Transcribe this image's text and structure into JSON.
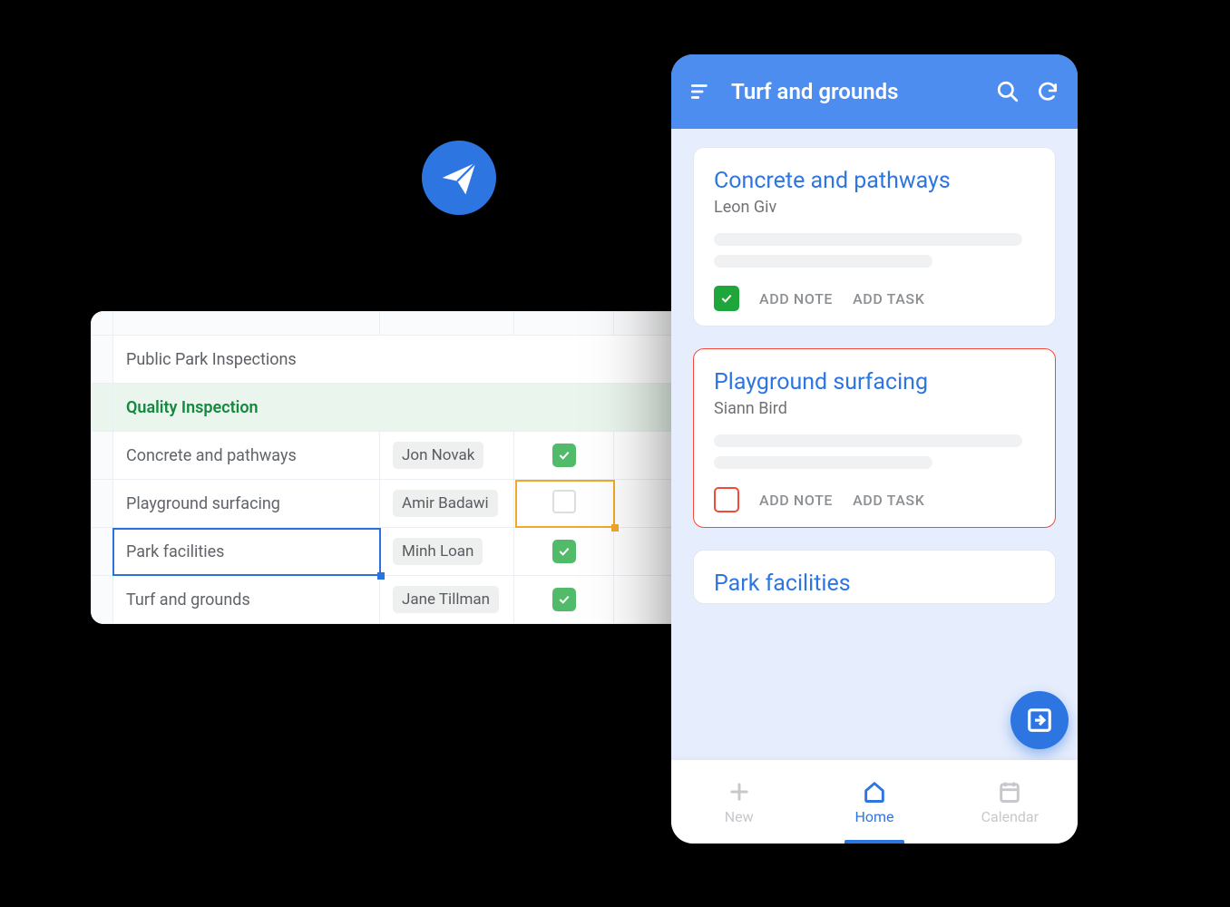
{
  "spreadsheet": {
    "title": "Public Park Inspections",
    "section": "Quality Inspection",
    "rows": [
      {
        "task": "Concrete and pathways",
        "person": "Jon Novak",
        "checked": true
      },
      {
        "task": "Playground surfacing",
        "person": "Amir Badawi",
        "checked": false
      },
      {
        "task": "Park facilities",
        "person": "Minh Loan",
        "checked": true
      },
      {
        "task": "Turf and grounds",
        "person": "Jane Tillman",
        "checked": true
      }
    ]
  },
  "phone": {
    "header_title": "Turf and grounds",
    "cards": [
      {
        "title": "Concrete and pathways",
        "person": "Leon Giv",
        "checked": true,
        "outline": "none"
      },
      {
        "title": "Playground surfacing",
        "person": "Siann Bird",
        "checked": false,
        "outline": "red"
      },
      {
        "title": "Park facilities",
        "person": "",
        "checked": null,
        "outline": "none"
      }
    ],
    "action_add_note": "ADD NOTE",
    "action_add_task": "ADD TASK",
    "nav": {
      "new": "New",
      "home": "Home",
      "calendar": "Calendar"
    }
  }
}
